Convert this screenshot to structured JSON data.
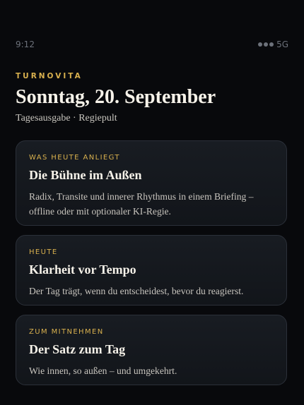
{
  "status": {
    "time": "9:12",
    "network": "5G",
    "signal_icon": "signal-dots-icon"
  },
  "header": {
    "brand": "TURNOVITA",
    "date": "Sonntag, 20. September",
    "subtitle": "Tagesausgabe · Regiepult"
  },
  "cards": [
    {
      "eyebrow": "WAS HEUTE ANLIEGT",
      "title": "Die Bühne im Außen",
      "body": "Radix, Transite und innerer Rhythmus in einem Briefing – offline oder mit optionaler KI-Regie."
    },
    {
      "eyebrow": "HEUTE",
      "title": "Klarheit vor Tempo",
      "body": "Der Tag trägt, wenn du entscheidest, bevor du reagierst."
    },
    {
      "eyebrow": "ZUM MITNEHMEN",
      "title": "Der Satz zum Tag",
      "body": "Wie innen, so außen – und umgekehrt."
    }
  ],
  "colors": {
    "background": "#08090c",
    "accent": "#d8b04e",
    "card_border": "#2b3039",
    "text_primary": "#f6f2e9",
    "text_secondary": "#c7c4bd",
    "status_text": "#6c717a"
  }
}
